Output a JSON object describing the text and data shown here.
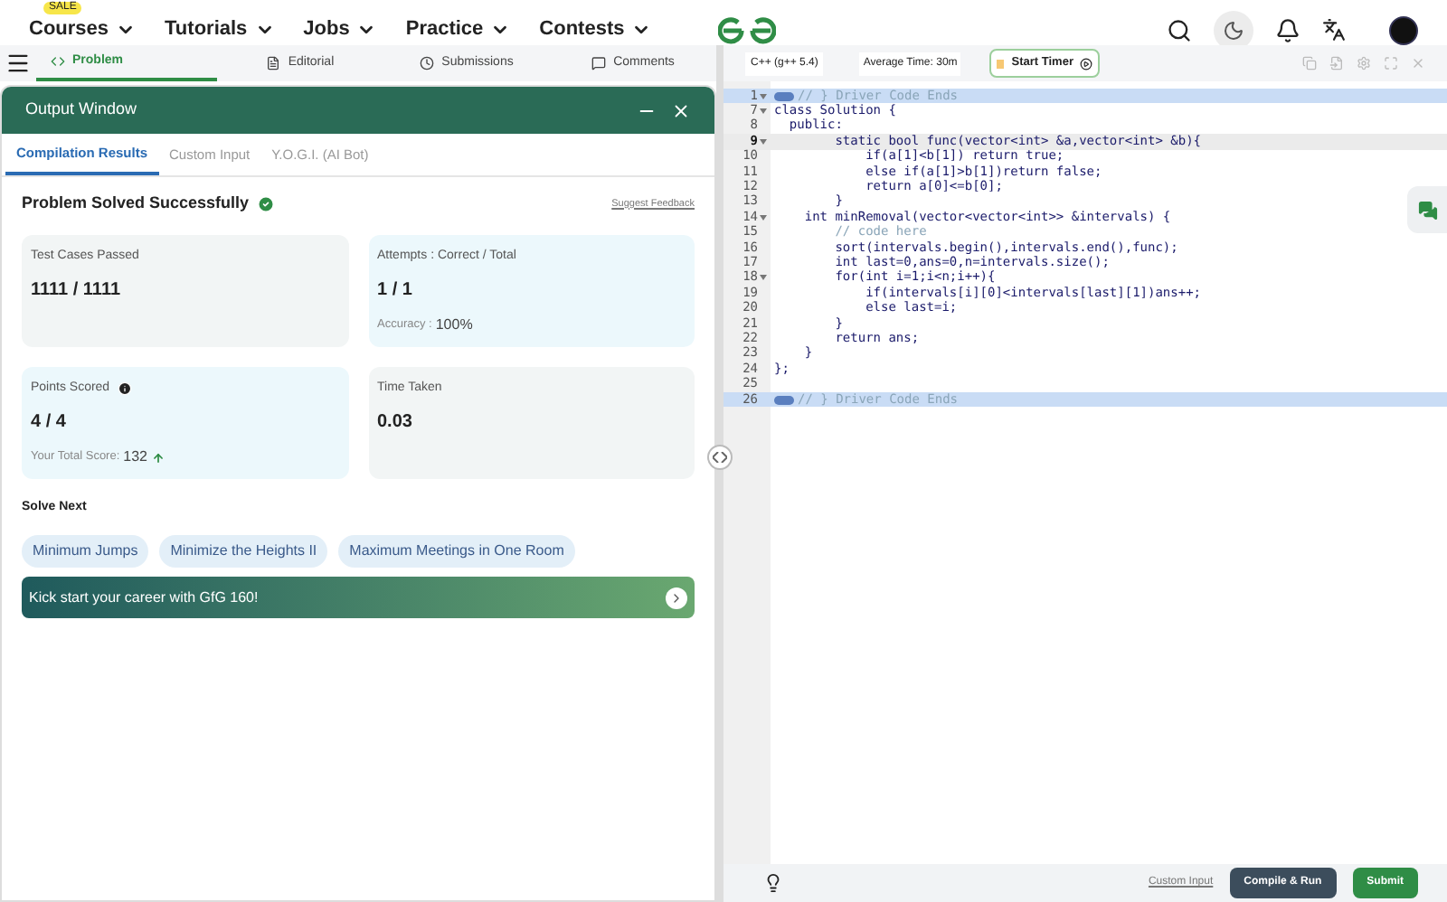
{
  "nav": {
    "badge": "SALE",
    "items": [
      {
        "label": "Courses"
      },
      {
        "label": "Tutorials"
      },
      {
        "label": "Jobs"
      },
      {
        "label": "Practice"
      },
      {
        "label": "Contests"
      }
    ]
  },
  "problem_tabs": [
    {
      "label": "Problem",
      "selected": true
    },
    {
      "label": "Editorial",
      "selected": false
    },
    {
      "label": "Submissions",
      "selected": false
    },
    {
      "label": "Comments",
      "selected": false
    }
  ],
  "output_window": {
    "title": "Output Window",
    "tabs": [
      {
        "label": "Compilation Results",
        "selected": true
      },
      {
        "label": "Custom Input",
        "selected": false
      },
      {
        "label": "Y.O.G.I. (AI Bot)",
        "selected": false
      }
    ],
    "status": "Problem Solved Successfully",
    "feedback_link": "Suggest Feedback",
    "cards": [
      {
        "label": "Test Cases Passed",
        "value": "1111 / 1111",
        "color": "#f2f5f5"
      },
      {
        "label": "Attempts : Correct / Total",
        "value": "1 / 1",
        "note_label": "Accuracy :",
        "note_value": "100%",
        "color": "#ecf8fc"
      },
      {
        "label": "Points Scored",
        "value": "4 / 4",
        "note_label": "Your Total Score:",
        "note_value": "132",
        "info": true,
        "trend_up": true,
        "color": "#ecf8fc"
      },
      {
        "label": "Time Taken",
        "value": "0.03",
        "color": "#f2f5f5"
      }
    ],
    "solve_next": {
      "title": "Solve Next",
      "items": [
        "Minimum Jumps",
        "Minimize the Heights II",
        "Maximum Meetings in One Room"
      ]
    },
    "banner": "Kick start your career with GfG 160!"
  },
  "editor": {
    "language": "C++ (g++ 5.4)",
    "average_time": "Average Time: 30m",
    "timer_button": "Start Timer",
    "lines": [
      {
        "number": "1",
        "fold": true,
        "text": "// } Driver Code Ends",
        "kind": "comment",
        "marker": true,
        "selected": true,
        "active": false
      },
      {
        "number": "7",
        "fold": true,
        "text": "class Solution {",
        "kind": "code",
        "marker": false,
        "selected": false,
        "active": false
      },
      {
        "number": "8",
        "fold": false,
        "text": "  public:",
        "kind": "code",
        "marker": false,
        "selected": false,
        "active": false
      },
      {
        "number": "9",
        "fold": true,
        "text": "        static bool func(vector<int> &a,vector<int> &b){",
        "kind": "code",
        "marker": false,
        "selected": false,
        "active": true
      },
      {
        "number": "10",
        "fold": false,
        "text": "            if(a[1]<b[1]) return true;",
        "kind": "code",
        "marker": false,
        "selected": false,
        "active": false
      },
      {
        "number": "11",
        "fold": false,
        "text": "            else if(a[1]>b[1])return false;",
        "kind": "code",
        "marker": false,
        "selected": false,
        "active": false
      },
      {
        "number": "12",
        "fold": false,
        "text": "            return a[0]<=b[0];",
        "kind": "code",
        "marker": false,
        "selected": false,
        "active": false
      },
      {
        "number": "13",
        "fold": false,
        "text": "        }",
        "kind": "code",
        "marker": false,
        "selected": false,
        "active": false
      },
      {
        "number": "14",
        "fold": true,
        "text": "    int minRemoval(vector<vector<int>> &intervals) {",
        "kind": "code",
        "marker": false,
        "selected": false,
        "active": false
      },
      {
        "number": "15",
        "fold": false,
        "text": "        // code here",
        "kind": "comment",
        "marker": false,
        "selected": false,
        "active": false
      },
      {
        "number": "16",
        "fold": false,
        "text": "        sort(intervals.begin(),intervals.end(),func);",
        "kind": "code",
        "marker": false,
        "selected": false,
        "active": false
      },
      {
        "number": "17",
        "fold": false,
        "text": "        int last=0,ans=0,n=intervals.size();",
        "kind": "code",
        "marker": false,
        "selected": false,
        "active": false
      },
      {
        "number": "18",
        "fold": true,
        "text": "        for(int i=1;i<n;i++){",
        "kind": "code",
        "marker": false,
        "selected": false,
        "active": false
      },
      {
        "number": "19",
        "fold": false,
        "text": "            if(intervals[i][0]<intervals[last][1])ans++;",
        "kind": "code",
        "marker": false,
        "selected": false,
        "active": false
      },
      {
        "number": "20",
        "fold": false,
        "text": "            else last=i;",
        "kind": "code",
        "marker": false,
        "selected": false,
        "active": false
      },
      {
        "number": "21",
        "fold": false,
        "text": "        }",
        "kind": "code",
        "marker": false,
        "selected": false,
        "active": false
      },
      {
        "number": "22",
        "fold": false,
        "text": "        return ans;",
        "kind": "code",
        "marker": false,
        "selected": false,
        "active": false
      },
      {
        "number": "23",
        "fold": false,
        "text": "    }",
        "kind": "code",
        "marker": false,
        "selected": false,
        "active": false
      },
      {
        "number": "24",
        "fold": false,
        "text": "};",
        "kind": "code",
        "marker": false,
        "selected": false,
        "active": false
      },
      {
        "number": "25",
        "fold": false,
        "marker": false,
        "selected": false,
        "active": false
      },
      {
        "number": "26",
        "fold": false,
        "text": "// } Driver Code Ends",
        "kind": "comment",
        "marker": true,
        "selected": true,
        "active": false
      }
    ],
    "custom_input": "Custom Input",
    "compile_button": "Compile & Run",
    "submit_button": "Submit"
  }
}
